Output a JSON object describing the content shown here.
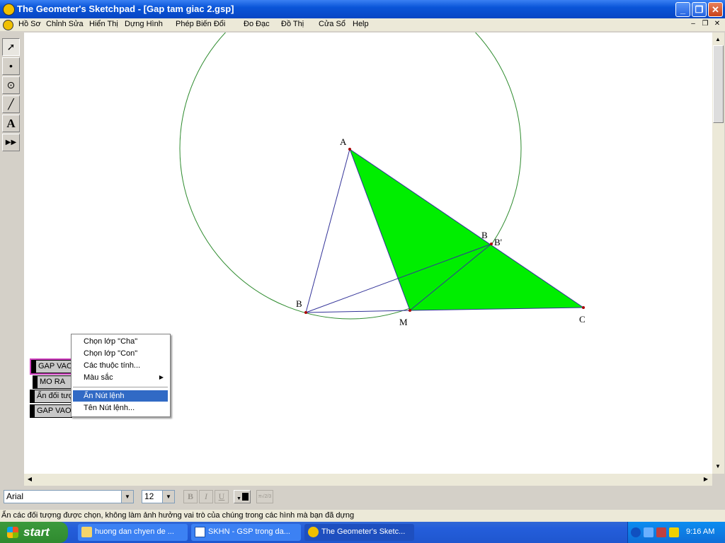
{
  "window": {
    "title": "The Geometer's Sketchpad - [Gap tam giac 2.gsp]",
    "controls": {
      "minimize": "_",
      "maximize": "❐",
      "close": "✕"
    }
  },
  "menubar": {
    "items": [
      "Hồ Sơ",
      "Chỉnh Sửa",
      "Hiển Thị",
      "Dựng Hình",
      "Phép Biến Đổi",
      "Đo Đạc",
      "Đồ Thị",
      "Cửa Sổ",
      "Help"
    ],
    "doc_controls": {
      "minimize": "–",
      "restore": "❐",
      "close": "✕"
    }
  },
  "toolbox": {
    "tools": [
      {
        "name": "select-arrow",
        "glyph": "➚"
      },
      {
        "name": "point",
        "glyph": "•"
      },
      {
        "name": "compass",
        "glyph": "⊙"
      },
      {
        "name": "straightedge",
        "glyph": "╱"
      },
      {
        "name": "text",
        "glyph": "A"
      },
      {
        "name": "custom",
        "glyph": "▶▶"
      }
    ]
  },
  "sketch": {
    "points": {
      "A": "A",
      "B": "B",
      "B_top": "B",
      "B_prime": "B'",
      "M": "M",
      "C": "C"
    },
    "fill_color": "#00ee00",
    "line_color": "#333399",
    "circle_color": "#2e8b2e"
  },
  "action_buttons": [
    {
      "label": "GAP VAO"
    },
    {
      "label": "MO RA"
    },
    {
      "label": "Ẩn đối tượng"
    },
    {
      "label": "GAP VAO"
    }
  ],
  "context_menu": {
    "items": [
      {
        "label": "Chọn lớp \"Cha\"",
        "submenu": false,
        "highlighted": false
      },
      {
        "label": "Chọn lớp \"Con\"",
        "submenu": false,
        "highlighted": false
      },
      {
        "label": "Các thuộc tính...",
        "submenu": false,
        "highlighted": false
      },
      {
        "label": "Màu sắc",
        "submenu": true,
        "highlighted": false
      },
      {
        "label": "Ẩn Nút lệnh",
        "submenu": false,
        "highlighted": true
      },
      {
        "label": "Tên Nút lệnh...",
        "submenu": false,
        "highlighted": false
      }
    ]
  },
  "text_toolbar": {
    "font": "Arial",
    "size": "12",
    "bold": "B",
    "italic": "I",
    "underline": "U",
    "math": "π√2/3"
  },
  "status_text": "Ẩn các đối tượng được chọn, không làm ảnh hưởng vai trò của chúng trong các hình mà bạn đã dựng",
  "taskbar": {
    "start": "start",
    "tasks": [
      {
        "label": "huong dan chyen de ...",
        "icon": "folder-icon",
        "active": false
      },
      {
        "label": "SKHN - GSP trong da...",
        "icon": "word-icon",
        "active": false
      },
      {
        "label": "The Geometer's Sketc...",
        "icon": "sketchpad-icon",
        "active": true
      }
    ],
    "clock": "9:16 AM"
  }
}
